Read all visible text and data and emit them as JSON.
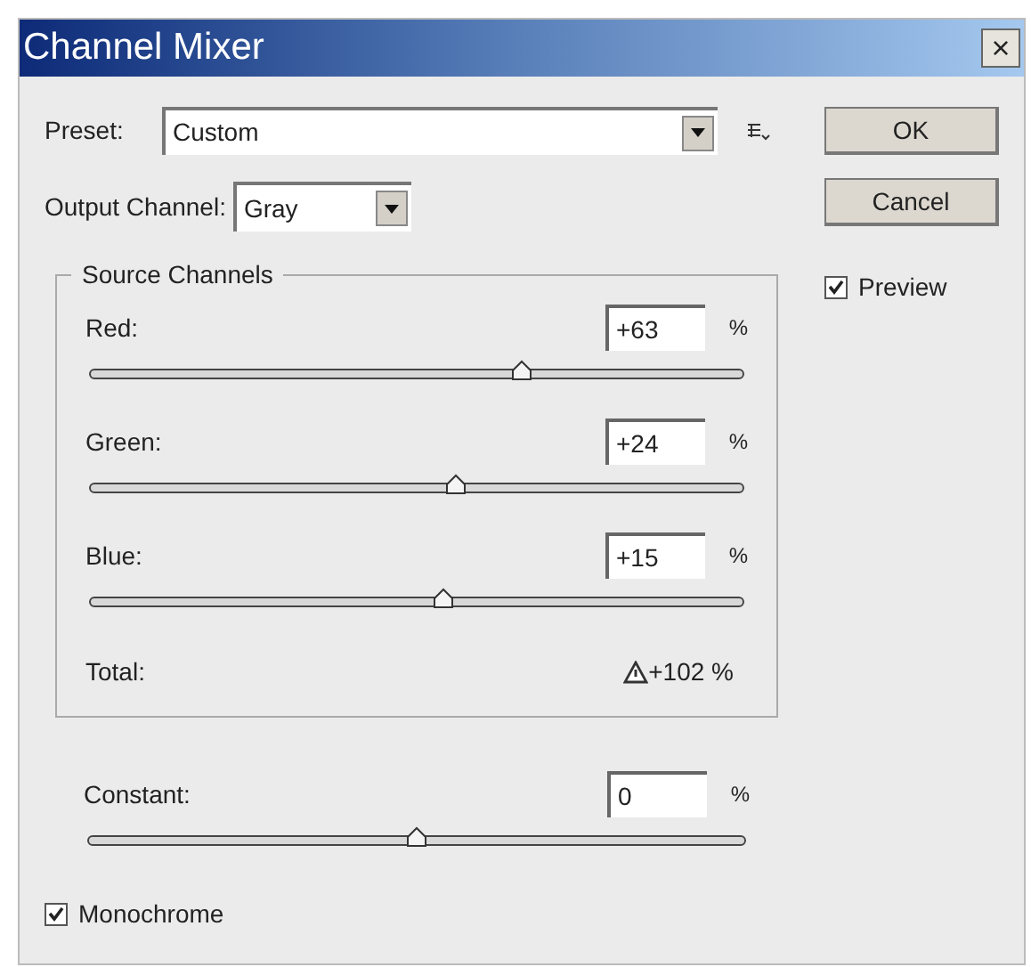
{
  "window": {
    "title": "Channel Mixer",
    "close": "×"
  },
  "preset": {
    "label": "Preset:",
    "value": "Custom"
  },
  "output_channel": {
    "label": "Output Channel:",
    "value": "Gray"
  },
  "buttons": [
    "OK",
    "Cancel"
  ],
  "preview": {
    "label": "Preview",
    "checked": true
  },
  "source_channels": {
    "title": "Source Channels",
    "channels": [
      {
        "name": "Red:",
        "value": "+63",
        "unit": "%",
        "level": 0.66
      },
      {
        "name": "Green:",
        "value": "+24",
        "unit": "%",
        "level": 0.56
      },
      {
        "name": "Blue:",
        "value": "+15",
        "unit": "%",
        "level": 0.54
      }
    ],
    "total": {
      "label": "Total:",
      "value": "+102 %",
      "warning": true
    }
  },
  "constant": {
    "name": "Constant:",
    "value": "0",
    "unit": "%",
    "level": 0.5
  },
  "monochrome": {
    "label": "Monochrome",
    "checked": true
  }
}
